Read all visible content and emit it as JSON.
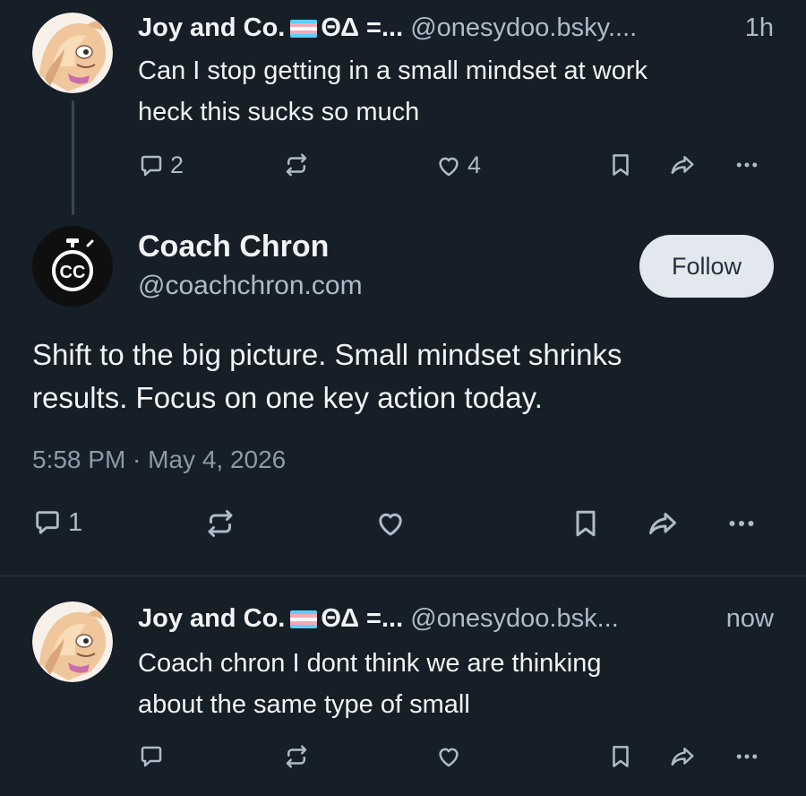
{
  "colors": {
    "background": "#161e27",
    "text": "#f1f3f5",
    "muted": "#aebbc9",
    "follow_bg": "#e3e8ee"
  },
  "post1": {
    "author_name": "Joy and Co.",
    "name_suffix": "ΘΔ =...",
    "handle": "@onesydoo.bsky....",
    "time": "1h",
    "text_line1": "Can I stop getting in a small mindset at work",
    "text_line2": "heck this sucks so much",
    "replies": "2",
    "likes": "4"
  },
  "main_post": {
    "avatar_text": "CC",
    "author_name": "Coach Chron",
    "handle": "@coachchron.com",
    "follow_label": "Follow",
    "text_line1": "Shift to the big picture. Small mindset shrinks",
    "text_line2": "results. Focus on one key action today.",
    "timestamp": "5:58 PM · May 4, 2026",
    "replies": "1"
  },
  "reply": {
    "author_name": "Joy and Co.",
    "name_suffix": "ΘΔ =...",
    "handle": "@onesydoo.bsk...",
    "time": "now",
    "text_line1": "Coach chron I dont think we are thinking",
    "text_line2": "about the same type of small"
  },
  "icons": [
    "reply-icon",
    "repost-icon",
    "like-icon",
    "bookmark-icon",
    "share-icon",
    "more-icon",
    "stopwatch-icon",
    "trans-flag-icon"
  ]
}
